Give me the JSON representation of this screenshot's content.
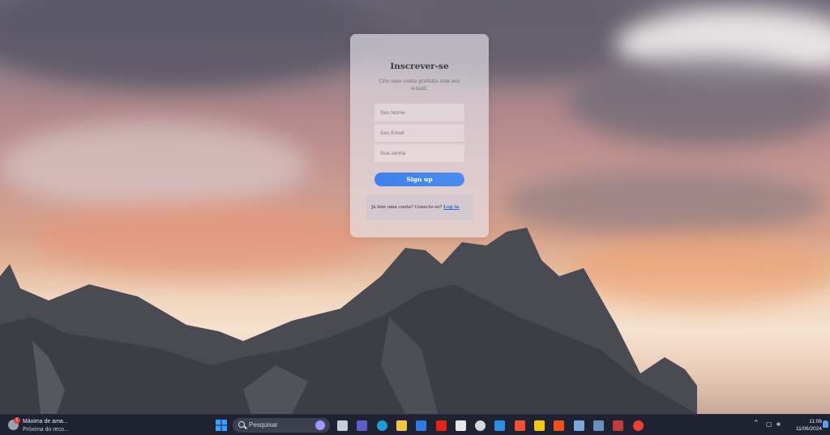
{
  "signup": {
    "title": "Inscrever-se",
    "subtitle": "Crie uma conta gratuita com seu e-mail.",
    "name_placeholder": "Seu Nome",
    "email_placeholder": "Seu Email",
    "password_placeholder": "Sua senha",
    "button_label": "Sign up",
    "login_prompt": "Já tem uma conta? Conecte-se?",
    "login_link": "Log in"
  },
  "taskbar": {
    "weather": {
      "line1": "Máxima de ama...",
      "line2": "Próxima do reco...",
      "badge": "1"
    },
    "search_placeholder": "Pesquisar",
    "apps": [
      {
        "name": "windows-start-icon",
        "color": "#3aa0ff"
      },
      {
        "name": "task-view-icon",
        "color": "#c9ccd6"
      },
      {
        "name": "teams-icon",
        "color": "#5b5fc7"
      },
      {
        "name": "edge-icon",
        "color": "#1f9bd7"
      },
      {
        "name": "file-explorer-icon",
        "color": "#f4c542"
      },
      {
        "name": "mail-icon",
        "color": "#2f7be6"
      },
      {
        "name": "youtube-icon",
        "color": "#e62117"
      },
      {
        "name": "microsoft-store-icon",
        "color": "#e8e8e8"
      },
      {
        "name": "obs-icon",
        "color": "#d8d8d8"
      },
      {
        "name": "vscode-icon",
        "color": "#2b8fe3"
      },
      {
        "name": "git-icon",
        "color": "#f05033"
      },
      {
        "name": "power-bi-icon",
        "color": "#f2c811"
      },
      {
        "name": "figma-icon",
        "color": "#f24e1e"
      },
      {
        "name": "pgadmin-icon",
        "color": "#7aa8d8"
      },
      {
        "name": "postgres-icon",
        "color": "#6a8fb8"
      },
      {
        "name": "winrar-icon",
        "color": "#c23b3b"
      },
      {
        "name": "chrome-icon",
        "color": "#e94235"
      }
    ],
    "time": "11:06",
    "date": "11/06/2024"
  }
}
